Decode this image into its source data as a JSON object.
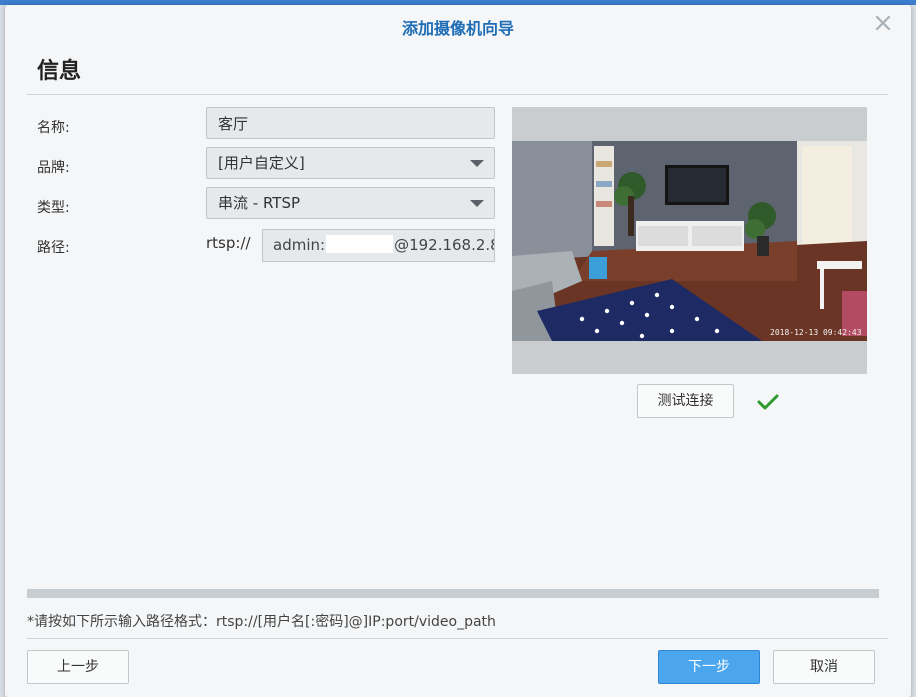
{
  "window": {
    "title": "添加摄像机向导"
  },
  "section": {
    "title": "信息"
  },
  "form": {
    "name_label": "名称:",
    "name_value": "客厅",
    "brand_label": "品牌:",
    "brand_value": "[用户自定义]",
    "type_label": "类型:",
    "type_value": "串流 - RTSP",
    "path_label": "路径:",
    "path_prefix": "rtsp://",
    "path_user": "admin:",
    "path_host": "@192.168.2.8"
  },
  "preview": {
    "timestamp": "2018-12-13 09:42:43"
  },
  "test": {
    "label": "测试连接",
    "status_icon": "check-icon",
    "status_color": "#2e9b2e"
  },
  "hint": {
    "text": "*请按如下所示输入路径格式：rtsp://[用户名[:密码]@]IP:port/video_path"
  },
  "footer": {
    "prev_label": "上一步",
    "next_label": "下一步",
    "cancel_label": "取消"
  },
  "colors": {
    "title": "#1f6db5",
    "primary_button": "#4ba6ee",
    "accent_bar": "#3d7ecf"
  }
}
